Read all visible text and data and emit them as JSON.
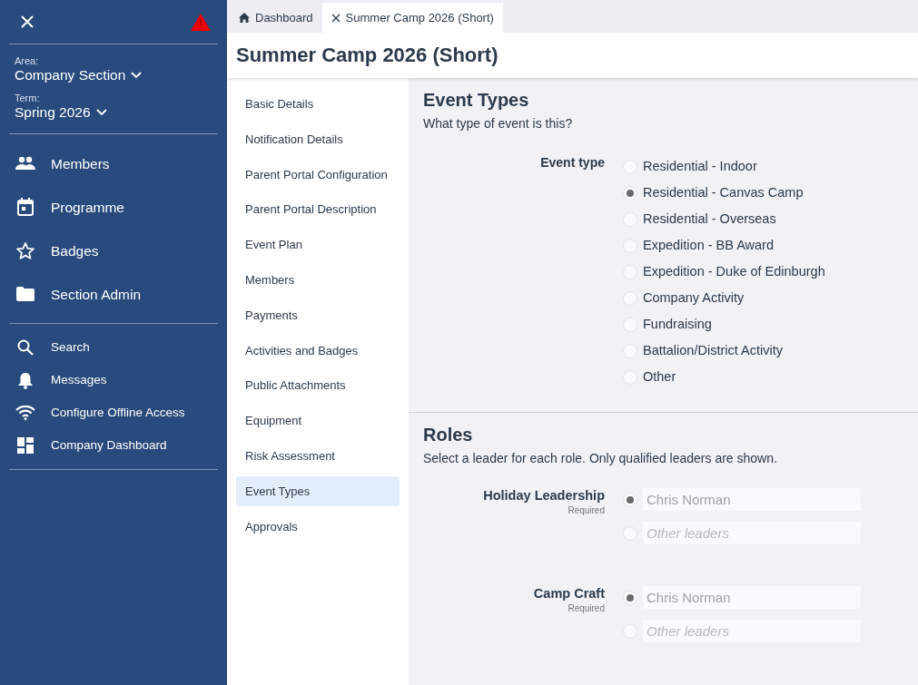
{
  "sidebar": {
    "area_label": "Area:",
    "area": "Company Section",
    "term_label": "Term:",
    "term": "Spring 2026",
    "main_items": [
      {
        "label": "Members"
      },
      {
        "label": "Programme"
      },
      {
        "label": "Badges"
      },
      {
        "label": "Section Admin"
      }
    ],
    "tool_items": [
      {
        "label": "Search"
      },
      {
        "label": "Messages"
      },
      {
        "label": "Configure Offline Access"
      },
      {
        "label": "Company Dashboard"
      }
    ]
  },
  "tabs": [
    {
      "label": "Dashboard",
      "selected": false
    },
    {
      "label": "Summer Camp 2026 (Short)",
      "selected": true
    }
  ],
  "page_title": "Summer Camp 2026 (Short)",
  "section_nav": [
    {
      "label": "Basic Details",
      "selected": false
    },
    {
      "label": "Notification Details",
      "selected": false
    },
    {
      "label": "Parent Portal Configuration",
      "selected": false
    },
    {
      "label": "Parent Portal Description",
      "selected": false
    },
    {
      "label": "Event Plan",
      "selected": false
    },
    {
      "label": "Members",
      "selected": false
    },
    {
      "label": "Payments",
      "selected": false
    },
    {
      "label": "Activities and Badges",
      "selected": false
    },
    {
      "label": "Public Attachments",
      "selected": false
    },
    {
      "label": "Equipment",
      "selected": false
    },
    {
      "label": "Risk Assessment",
      "selected": false
    },
    {
      "label": "Event Types",
      "selected": true
    },
    {
      "label": "Approvals",
      "selected": false
    }
  ],
  "event_types": {
    "heading": "Event Types",
    "description": "What type of event is this?",
    "field_label": "Event type",
    "options": [
      {
        "label": "Residential - Indoor",
        "selected": false
      },
      {
        "label": "Residential - Canvas Camp",
        "selected": true
      },
      {
        "label": "Residential - Overseas",
        "selected": false
      },
      {
        "label": "Expedition - BB Award",
        "selected": false
      },
      {
        "label": "Expedition - Duke of Edinburgh",
        "selected": false
      },
      {
        "label": "Company Activity",
        "selected": false
      },
      {
        "label": "Fundraising",
        "selected": false
      },
      {
        "label": "Battalion/District Activity",
        "selected": false
      },
      {
        "label": "Other",
        "selected": false
      }
    ]
  },
  "roles": {
    "heading": "Roles",
    "description": "Select a leader for each role. Only qualified leaders are shown.",
    "items": [
      {
        "name": "Holiday Leadership",
        "note": "Required",
        "options": [
          {
            "value": "Chris Norman",
            "selected": true
          },
          {
            "placeholder": "Other leaders",
            "selected": false
          }
        ]
      },
      {
        "name": "Camp Craft",
        "note": "Required",
        "options": [
          {
            "value": "Chris Norman",
            "selected": true
          },
          {
            "placeholder": "Other leaders",
            "selected": false
          }
        ]
      }
    ]
  }
}
